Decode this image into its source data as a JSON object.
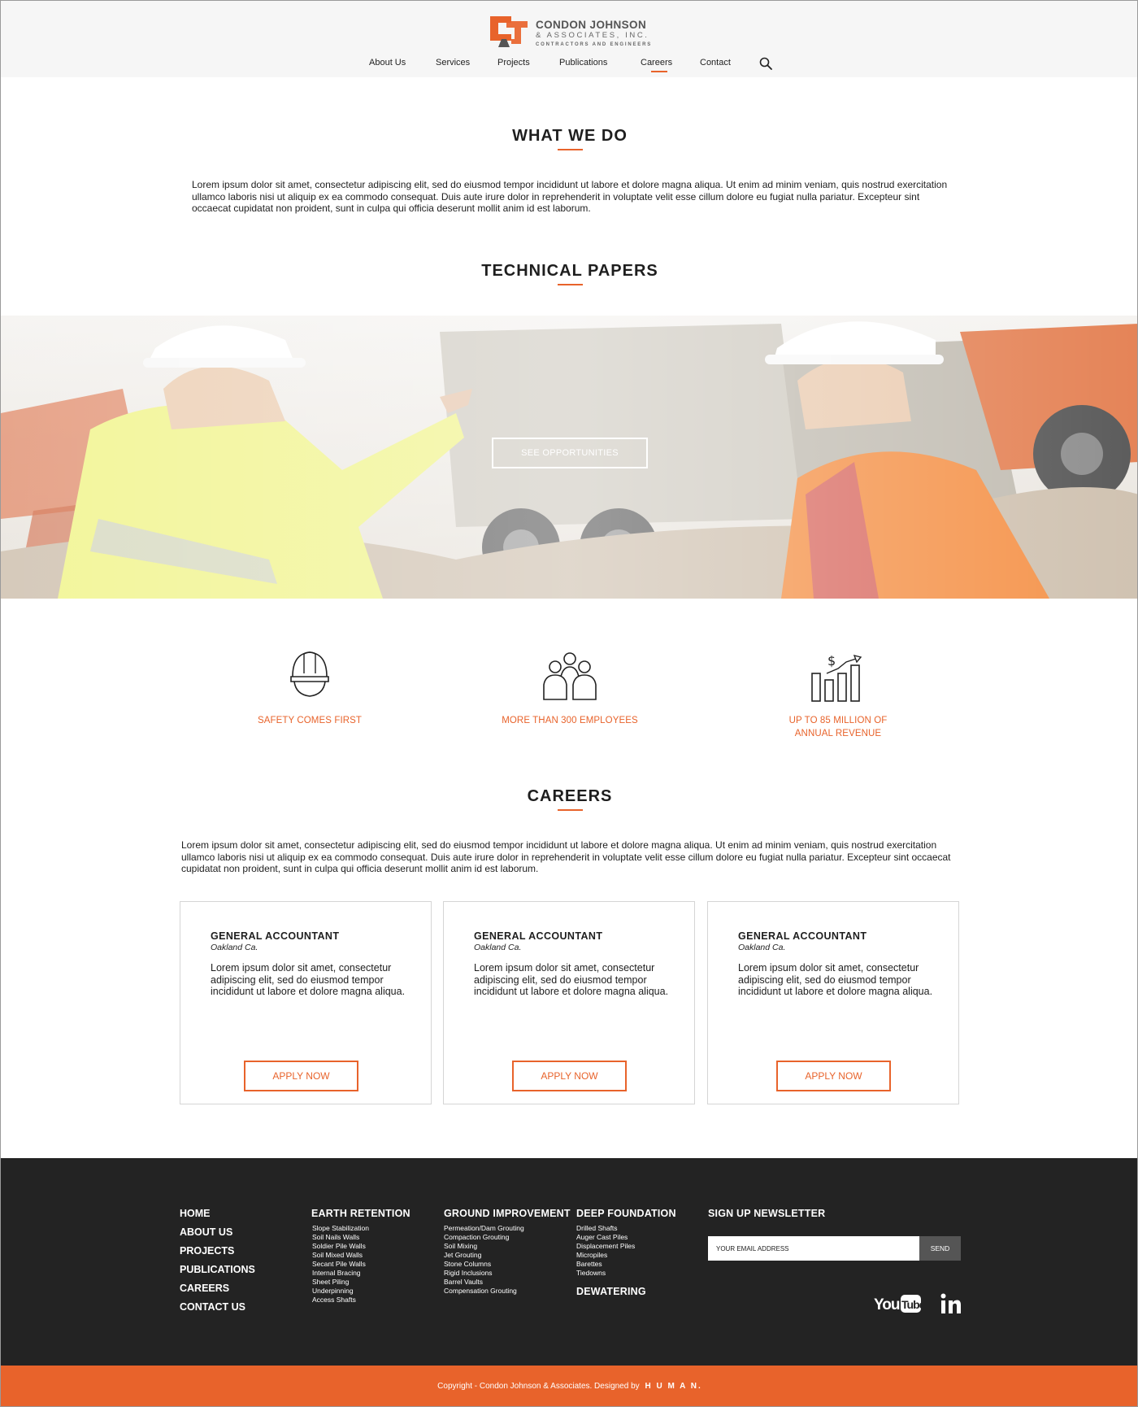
{
  "header": {
    "logo": {
      "line1": "CONDON JOHNSON",
      "line2": "& ASSOCIATES, INC.",
      "line3": "CONTRACTORS AND ENGINEERS"
    },
    "nav": [
      "About Us",
      "Services",
      "Projects",
      "Publications",
      "Careers",
      "Contact"
    ],
    "active_nav": "Careers"
  },
  "what_we_do": {
    "title": "WHAT WE DO",
    "text": "Lorem ipsum dolor sit amet, consectetur adipiscing elit, sed do eiusmod tempor incididunt ut labore et dolore magna aliqua. Ut enim ad minim veniam, quis nostrud exercitation ullamco laboris nisi ut aliquip ex ea commodo consequat. Duis aute irure dolor in reprehenderit in voluptate velit esse cillum dolore eu fugiat nulla pariatur. Excepteur sint occaecat cupidatat non proident, sunt in culpa qui officia deserunt mollit anim id est laborum."
  },
  "technical_papers": {
    "title": "TECHNICAL PAPERS",
    "button": "SEE OPPORTUNITIES"
  },
  "features": [
    {
      "icon": "hard-hat-icon",
      "label": "SAFETY COMES FIRST"
    },
    {
      "icon": "employees-icon",
      "label": "MORE THAN 300 EMPLOYEES"
    },
    {
      "icon": "revenue-chart-icon",
      "label_line1": "UP TO 85 MILLION OF",
      "label_line2": "ANNUAL REVENUE"
    }
  ],
  "careers": {
    "title": "CAREERS",
    "text": "Lorem ipsum dolor sit amet, consectetur adipiscing elit, sed do eiusmod tempor incididunt ut labore et dolore magna aliqua. Ut enim ad minim veniam, quis nostrud exercitation ullamco laboris nisi ut aliquip ex ea commodo consequat. Duis aute irure dolor in reprehenderit in voluptate velit esse cillum dolore eu fugiat nulla pariatur. Excepteur sint occaecat cupidatat non proident, sunt in culpa qui officia deserunt mollit anim id est laborum.",
    "jobs": [
      {
        "title": "GENERAL ACCOUNTANT",
        "location": "Oakland Ca.",
        "description": "Lorem ipsum dolor sit amet, consectetur adipiscing elit, sed do eiusmod tempor incididunt ut labore et dolore magna aliqua.",
        "button": "APPLY NOW"
      },
      {
        "title": "GENERAL ACCOUNTANT",
        "location": "Oakland Ca.",
        "description": "Lorem ipsum dolor sit amet, consectetur adipiscing elit, sed do eiusmod tempor incididunt ut labore et dolore magna aliqua.",
        "button": "APPLY NOW"
      },
      {
        "title": "GENERAL ACCOUNTANT",
        "location": "Oakland Ca.",
        "description": "Lorem ipsum dolor sit amet, consectetur adipiscing elit, sed do eiusmod tempor incididunt ut labore et dolore magna aliqua.",
        "button": "APPLY NOW"
      }
    ]
  },
  "footer": {
    "main_links": [
      "HOME",
      "ABOUT US",
      "PROJECTS",
      "PUBLICATIONS",
      "CAREERS",
      "CONTACT US"
    ],
    "earth_retention": {
      "title": "EARTH RETENTION",
      "items": [
        "Slope Stabilization",
        "Soil Nails Walls",
        "Soldier Pile Walls",
        "Soil Mixed Walls",
        "Secant Pile Walls",
        "Internal Bracing",
        "Sheet Piling",
        "Underpinning",
        "Access Shafts"
      ]
    },
    "ground_improvement": {
      "title": "GROUND IMPROVEMENT",
      "items": [
        "Permeation/Dam Grouting",
        "Compaction Grouting",
        "Soil Mixing",
        "Jet Grouting",
        "Stone Columns",
        "Rigid Inclusions",
        "Barrel Vaults",
        "Compensation Grouting"
      ]
    },
    "deep_foundation": {
      "title": "DEEP FOUNDATION",
      "items": [
        "Drilled Shafts",
        "Auger Cast Piles",
        "Displacement Piles",
        "Micropiles",
        "Barettes",
        "Tiedowns"
      ]
    },
    "dewatering": {
      "title": "DEWATERING"
    },
    "newsletter": {
      "title": "SIGN UP NEWSLETTER",
      "placeholder": "YOUR EMAIL ADDRESS",
      "button": "SEND"
    },
    "social": [
      "youtube-icon",
      "linkedin-icon"
    ]
  },
  "copyright": {
    "text": "Copyright - Condon Johnson & Associates. Designed by",
    "brand": "H U M A N."
  },
  "colors": {
    "accent": "#e8632b",
    "footer_bg": "#232323",
    "header_bg": "#f6f6f6"
  }
}
